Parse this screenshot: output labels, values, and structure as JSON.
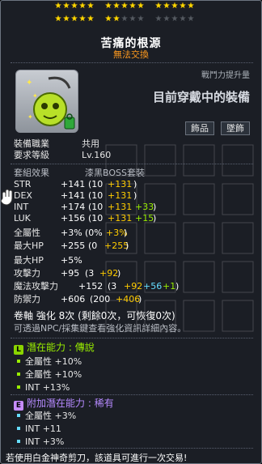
{
  "stars": {
    "filled": 17,
    "total": 25
  },
  "item": {
    "name": "苦痛的根源",
    "trade_status": "無法交換",
    "power_label": "戰鬥力提升量",
    "power_value": "目前穿戴中的裝備",
    "tags": [
      "飾品",
      "墜飾"
    ]
  },
  "requirements": {
    "job_label": "裝備職業",
    "job_value": "共用",
    "level_label": "要求等級",
    "level_value": "Lv.160"
  },
  "set": {
    "label": "套組效果",
    "value": "漆黑BOSS套裝"
  },
  "stats": [
    {
      "label": "STR",
      "total": "+141",
      "open": "(10",
      "star": "+131",
      "potential": "",
      "close": ")"
    },
    {
      "label": "DEX",
      "total": "+141",
      "open": "(10",
      "star": "+131",
      "potential": "",
      "close": ")"
    },
    {
      "label": "INT",
      "total": "+174",
      "open": "(10",
      "star": "+131",
      "potential": "+33",
      "close": ")"
    },
    {
      "label": "LUK",
      "total": "+156",
      "open": "(10",
      "star": "+131",
      "potential": "+15",
      "close": ")"
    },
    {
      "label": "全屬性",
      "total": "+3%",
      "open": "(0%",
      "star": "+3%",
      "potential": "",
      "close": ")"
    },
    {
      "label": "最大HP",
      "total": "+255",
      "open": "(0",
      "star": "+255",
      "potential": "",
      "close": ")"
    },
    {
      "label": "最大HP",
      "total": "+5%",
      "open": "",
      "star": "",
      "potential": "",
      "close": ""
    },
    {
      "label": "攻擊力",
      "total": "+95",
      "open": "(3",
      "star": "+92",
      "potential": "",
      "close": ")"
    },
    {
      "label": "魔法攻擊力",
      "total": "+152",
      "open": "(3",
      "star": "+92",
      "potential": "+56",
      "extra": "+1",
      "close": ")"
    },
    {
      "label": "防禦力",
      "total": "+606",
      "open": "(200",
      "star": "+406",
      "potential": "",
      "close": ")"
    }
  ],
  "scroll": {
    "line": "卷軸 強化 8次 (剩餘0次，可恢復0次)",
    "note": "可透過NPC/採集鍵查看強化資訊詳細內容。"
  },
  "potential": {
    "icon": "L",
    "icon_color": "#8ad400",
    "title_prefix": "潛在能力 :",
    "title_grade": "傳說",
    "color": "#99ee00",
    "lines": [
      "全屬性 +10%",
      "全屬性 +10%",
      "INT +13%"
    ]
  },
  "additional": {
    "icon": "E",
    "icon_color": "#c78cff",
    "title_prefix": "附加潛在能力 :",
    "title_grade": "稀有",
    "color": "#b68aff",
    "lines": [
      "全屬性 +3%",
      "INT +11",
      "INT +3%"
    ]
  },
  "footer": "若使用白金神奇剪刀，該道具可進行一次交易!"
}
